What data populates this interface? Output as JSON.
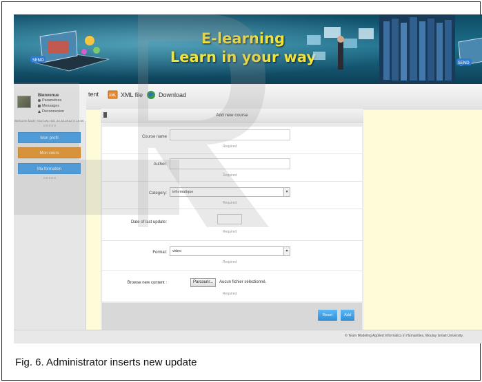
{
  "banner": {
    "title_line1": "E-learning",
    "title_line2": "Learn in your way",
    "laptop_label": "SEND"
  },
  "toolbar": {
    "partial_item": "tent",
    "xml_label": "XML file",
    "download_label": "Download"
  },
  "user": {
    "welcome": "Bienvenue",
    "menu": [
      {
        "icon": "gear-icon",
        "label": "Paramètres"
      },
      {
        "icon": "message-icon",
        "label": "Messages"
      },
      {
        "icon": "logout-icon",
        "label": "Deconnexion"
      }
    ],
    "last_visit": "Welcome back! Your last visit: 24.10.2012 in 19:00"
  },
  "side_buttons": [
    {
      "label": "Mon profil",
      "color": "#3a9be8"
    },
    {
      "label": "Mon cours",
      "color": "#e8901f"
    },
    {
      "label": "Ma formation",
      "color": "#3a9be8"
    }
  ],
  "form": {
    "title": "Add new course",
    "required_text": "Required",
    "fields": {
      "course_name": {
        "label": "Course name",
        "value": ""
      },
      "author": {
        "label": "Author:",
        "value": ""
      },
      "category": {
        "label": "Category:",
        "value": "informatique"
      },
      "date": {
        "label": "Date of last update:",
        "value": ""
      },
      "format": {
        "label": "Format:",
        "value": "video"
      },
      "content": {
        "label": "Browse new content :",
        "button": "Parcourir...",
        "status": "Aucun fichier sélectionné."
      }
    },
    "reset_label": "Reset",
    "add_label": "Add"
  },
  "footer": {
    "copyright": "© Team Modeling Applied Informatics in Humanities, Moulay Ismail University,"
  },
  "caption": "Fig. 6. Administrator inserts new update",
  "colors": {
    "banner_title": "#f2e33a",
    "page_background": "#fdfbd8",
    "button_blue": "#3a9be8",
    "button_orange": "#e8901f"
  }
}
